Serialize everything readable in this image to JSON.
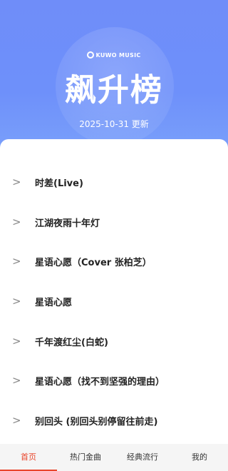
{
  "header": {
    "brand": "KUWO MUSIC",
    "title": "飙升榜",
    "date": "2025-10-31 更新"
  },
  "songs": [
    {
      "title": "时差(Live)"
    },
    {
      "title": "江湖夜雨十年灯"
    },
    {
      "title": "星语心愿（Cover 张柏芝）"
    },
    {
      "title": "星语心愿"
    },
    {
      "title": "千年渡红尘(白蛇)"
    },
    {
      "title": "星语心愿（找不到坚强的理由）"
    },
    {
      "title": "别回头 (别回头别停留往前走)"
    }
  ],
  "tabs": [
    {
      "label": "首页",
      "active": true
    },
    {
      "label": "热门金曲"
    },
    {
      "label": "经典流行"
    },
    {
      "label": "我的"
    }
  ],
  "colors": {
    "hero": "#6f8df9",
    "accent": "#e9452b"
  }
}
